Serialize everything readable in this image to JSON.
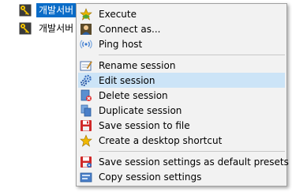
{
  "tree": {
    "items": [
      {
        "label": "개발서버",
        "icon": "key-icon",
        "selected": true
      },
      {
        "label": "개발서버",
        "icon": "key-icon",
        "selected": false
      }
    ]
  },
  "context_menu": {
    "items": [
      {
        "label": "Execute",
        "icon": "star-icon"
      },
      {
        "label": "Connect as...",
        "icon": "user-icon"
      },
      {
        "label": "Ping host",
        "icon": "signal-icon"
      },
      {
        "label": "Rename session",
        "icon": "rename-icon"
      },
      {
        "label": "Edit session",
        "icon": "gears-icon",
        "highlighted": true
      },
      {
        "label": "Delete session",
        "icon": "delete-icon"
      },
      {
        "label": "Duplicate session",
        "icon": "duplicate-icon"
      },
      {
        "label": "Save session to file",
        "icon": "save-icon"
      },
      {
        "label": "Create a desktop shortcut",
        "icon": "star-shortcut-icon"
      },
      {
        "label": "Save session settings as default presets",
        "icon": "save-presets-icon"
      },
      {
        "label": "Copy session settings",
        "icon": "copy-icon"
      }
    ]
  },
  "colors": {
    "selection": "#0a6cc8",
    "hover": "#cce4f7",
    "menu_bg": "#f2f2f2"
  }
}
